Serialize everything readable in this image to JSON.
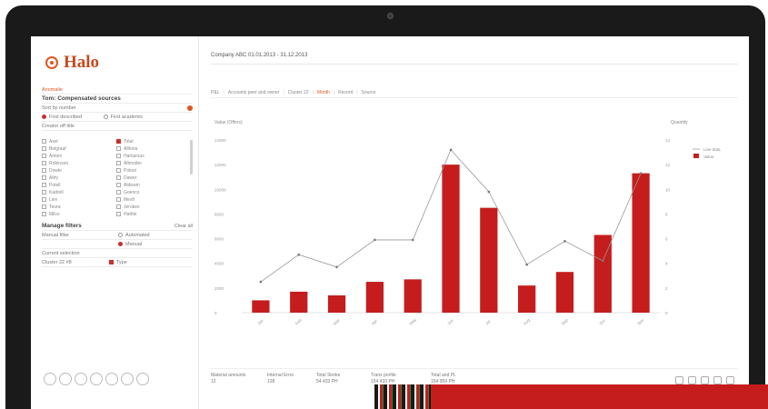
{
  "app": {
    "logo_text": "Halo"
  },
  "header": {
    "title": "Company ABC 01.01.2013 - 31.12.2013"
  },
  "breadcrumbs": [
    "P&L",
    "Accounts peer and owner",
    "Cluster 22",
    "Month",
    "Record",
    "Source"
  ],
  "left_panel": {
    "section1_label": "Anomalie",
    "subtitle": "Tom: Compensated sources",
    "search_label": "Sort by number",
    "radio_options": [
      {
        "label": "First described",
        "selected": true
      },
      {
        "label": "First academic",
        "selected": false
      }
    ],
    "list_title": "Creator off title",
    "names_left": [
      "Asst",
      "Belgraaf",
      "Antoin",
      "Robinson",
      "Dowle",
      "Altry",
      "Potell",
      "Kadrell",
      "Liev",
      "Teura",
      "Milvo"
    ],
    "names_right": [
      "Total",
      "Alltoria",
      "Hamarsus",
      "Altmotter",
      "Polest",
      "Dawer",
      "Aldwam",
      "Goencs",
      "Mesh",
      "Jerokes",
      "Hathle"
    ],
    "manage_title": "Manage filters",
    "manage_clear": "Clear all",
    "manual_label": "Manual filter",
    "manual_options": [
      {
        "label": "Automated",
        "selected": false
      },
      {
        "label": "Manual",
        "selected": true
      }
    ],
    "current_label": "Current selection",
    "cluster_label": "Cluster 22 #8",
    "type_label": "Type"
  },
  "chart_data": {
    "type": "bar",
    "categories": [
      "Jan",
      "Feb",
      "Mar",
      "Apr",
      "May",
      "Jun",
      "Jul",
      "Aug",
      "Sep",
      "Oct",
      "Nov"
    ],
    "series": [
      {
        "name": "Value",
        "type": "bar",
        "color": "#c51d1d",
        "values": [
          1000,
          1700,
          1400,
          2500,
          2700,
          12000,
          8500,
          2200,
          3300,
          6300,
          11300
        ]
      },
      {
        "name": "Line data",
        "type": "line",
        "axis": "right",
        "color": "#999999",
        "values": [
          2.5,
          4.7,
          3.7,
          5.9,
          5.9,
          13.2,
          9.8,
          3.9,
          5.8,
          4.2,
          11.3
        ]
      }
    ],
    "ylabel": "Value (Offers)",
    "y2label": "Quantity",
    "ylim": [
      0,
      14000
    ],
    "y2lim": [
      0,
      14
    ],
    "yticks": [
      0,
      2000,
      4000,
      6000,
      8000,
      10000,
      12000,
      14000
    ],
    "y2ticks": [
      0,
      2,
      4,
      6,
      8,
      10,
      12,
      14
    ],
    "legend": [
      "Line data",
      "Value"
    ],
    "legend_position": "top-right"
  },
  "footer": {
    "stats": [
      {
        "label": "Material amounts",
        "value": "12"
      },
      {
        "label": "Internal Error",
        "value": "128"
      },
      {
        "label": "Total Stroke",
        "value": "54 433 PH"
      },
      {
        "label": "Trans profile",
        "value": "154 433 PH"
      },
      {
        "label": "Total and PL",
        "value": "154 959 PH"
      }
    ]
  },
  "colors": {
    "accent": "#e0571f",
    "bar": "#c51d1d",
    "line": "#999999"
  }
}
